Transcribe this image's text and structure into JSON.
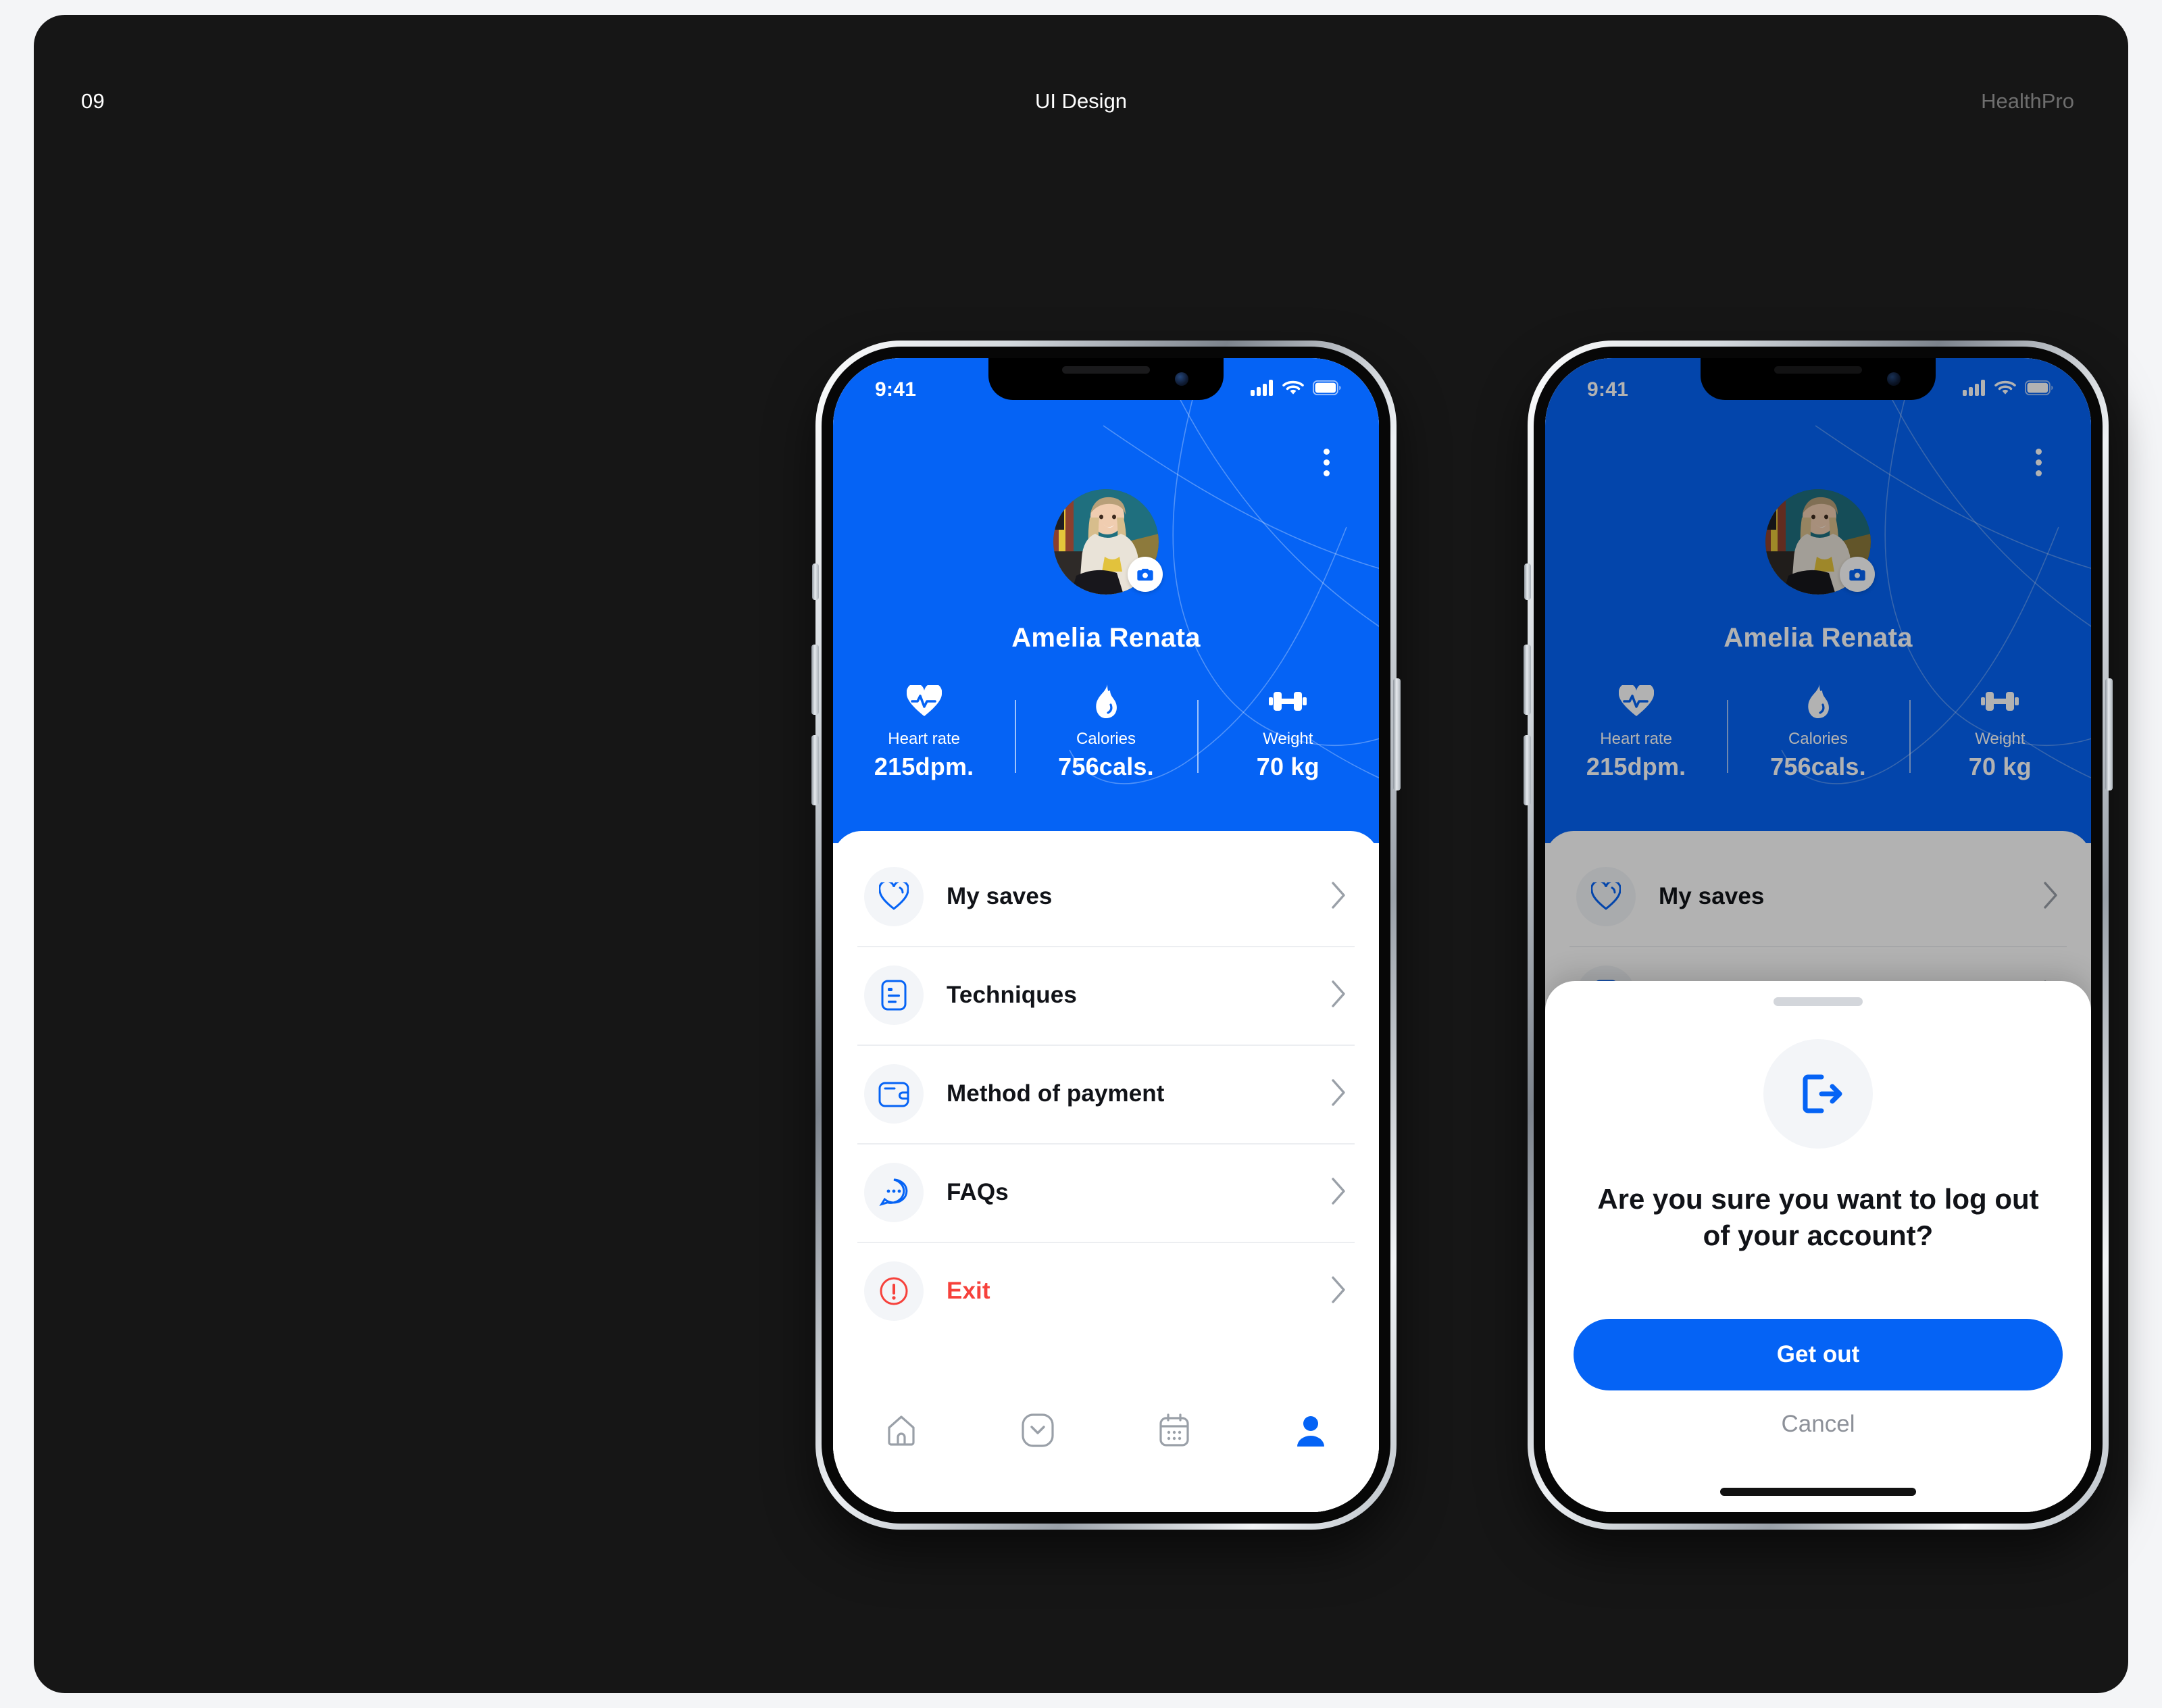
{
  "slide": {
    "number": "09",
    "title": "UI Design",
    "brand": "HealthPro"
  },
  "colors": {
    "accent_blue": "#0563F5",
    "danger_red": "#F6413B",
    "canvas_dark": "#161616",
    "page_bg": "#F4F5F7",
    "icon_bg": "#F3F5F8",
    "muted_text": "#8D9199"
  },
  "status_bar": {
    "time": "9:41",
    "icons": [
      "cellular-signal-icon",
      "wifi-icon",
      "battery-icon"
    ]
  },
  "profile": {
    "name": "Amelia Renata",
    "avatar_name": "user-avatar-photo",
    "camera_badge": "camera-icon",
    "menu_icon": "kebab-menu-icon",
    "stats": [
      {
        "icon": "heart-pulse-icon",
        "label": "Heart rate",
        "value": "215dpm."
      },
      {
        "icon": "flame-icon",
        "label": "Calories",
        "value": "756cals."
      },
      {
        "icon": "dumbbell-icon",
        "label": "Weight",
        "value": "70 kg"
      }
    ]
  },
  "menu": {
    "items": [
      {
        "icon": "heart-outline-icon",
        "label": "My saves",
        "danger": false
      },
      {
        "icon": "document-list-icon",
        "label": "Techniques",
        "danger": false
      },
      {
        "icon": "wallet-icon",
        "label": "Method of payment",
        "danger": false
      },
      {
        "icon": "chat-bubble-icon",
        "label": "FAQs",
        "danger": false
      },
      {
        "icon": "alert-circle-icon",
        "label": "Exit",
        "danger": true
      }
    ],
    "chevron": "chevron-right-icon"
  },
  "tabbar": {
    "items": [
      {
        "icon": "home-icon",
        "active": false
      },
      {
        "icon": "inbox-icon",
        "active": false
      },
      {
        "icon": "calendar-icon",
        "active": false
      },
      {
        "icon": "profile-icon",
        "active": true
      }
    ]
  },
  "logout_sheet": {
    "handle": "drag-handle",
    "icon": "logout-icon",
    "title": "Are you sure you want to log out of your account?",
    "primary_label": "Get out",
    "cancel_label": "Cancel"
  }
}
